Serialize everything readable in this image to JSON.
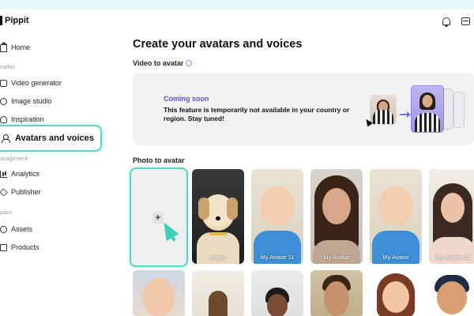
{
  "app": {
    "name": "Pippit"
  },
  "sidebar": {
    "items": [
      {
        "label": "Home",
        "icon": "home-icon"
      },
      {
        "label": "Video generator",
        "icon": "video-icon"
      },
      {
        "label": "Image studio",
        "icon": "image-icon"
      },
      {
        "label": "Inspiration",
        "icon": "bulb-icon"
      },
      {
        "label": "Avatars and voices",
        "icon": "avatar-icon",
        "active": true
      },
      {
        "label": "Analytics",
        "icon": "chart-icon"
      },
      {
        "label": "Publisher",
        "icon": "send-icon"
      },
      {
        "label": "Assets",
        "icon": "cloud-icon"
      },
      {
        "label": "Products",
        "icon": "box-icon"
      }
    ],
    "sections": [
      "eation",
      "anagement",
      "pace"
    ]
  },
  "header": {
    "icons": [
      "bell-icon",
      "inbox-icon"
    ]
  },
  "main": {
    "title": "Create your avatars and voices",
    "video_section": {
      "label": "Video to avatar",
      "banner_heading": "Coming soon",
      "banner_text": "This feature is temporarily not available in your country or region. Stay tuned!"
    },
    "photo_section": {
      "label": "Photo to avatar",
      "add_symbol": "+",
      "tiles": [
        {
          "caption": "puppy"
        },
        {
          "caption": "My Avatar 11"
        },
        {
          "caption": "My Avatar"
        },
        {
          "caption": "My Avatar"
        },
        {
          "caption": "My Avatar 11"
        }
      ]
    }
  },
  "colors": {
    "accent_teal": "#55d6c5",
    "coming_soon_purple": "#5b57d6",
    "banner_bg": "#f1f1f1",
    "top_strip": "#e4f6fa"
  }
}
